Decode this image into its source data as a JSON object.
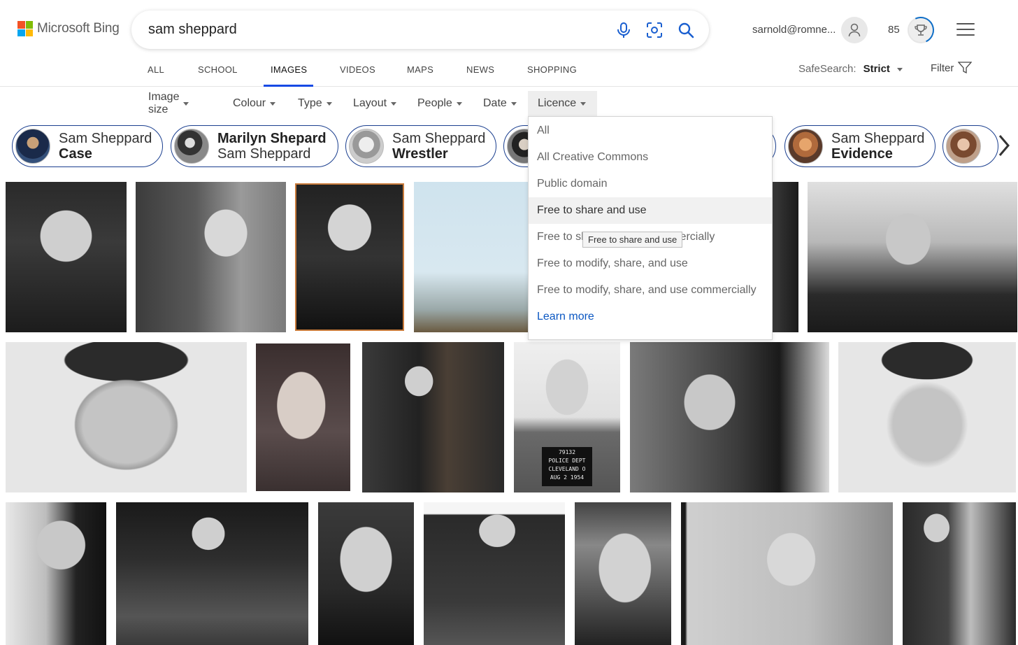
{
  "logo": {
    "text": "Microsoft Bing",
    "colors": [
      "#f35325",
      "#81bc06",
      "#05a6f0",
      "#ffba08"
    ]
  },
  "search": {
    "query": "sam sheppard",
    "mic_icon": "microphone-icon",
    "visual_search_icon": "visual-search-icon",
    "search_icon": "search-icon"
  },
  "header": {
    "account": "sarnold@romne...",
    "points": "85"
  },
  "nav": {
    "tabs": [
      {
        "label": "ALL"
      },
      {
        "label": "SCHOOL"
      },
      {
        "label": "IMAGES",
        "active": true
      },
      {
        "label": "VIDEOS"
      },
      {
        "label": "MAPS"
      },
      {
        "label": "NEWS"
      },
      {
        "label": "SHOPPING"
      }
    ],
    "safesearch_label": "SafeSearch:",
    "safesearch_value": "Strict",
    "filter_label": "Filter"
  },
  "filters": [
    {
      "label": "Image size"
    },
    {
      "label": "Colour"
    },
    {
      "label": "Type"
    },
    {
      "label": "Layout"
    },
    {
      "label": "People"
    },
    {
      "label": "Date"
    },
    {
      "label": "Licence",
      "open": true
    }
  ],
  "chips": [
    {
      "line1": "Sam Sheppard",
      "line2": "Case",
      "bold_line": 2
    },
    {
      "line1": "Marilyn Shepard",
      "line2": "Sam Sheppard",
      "bold_line": 1
    },
    {
      "line1": "Sam Sheppard",
      "line2": "Wrestler",
      "bold_line": 2
    },
    {
      "line1": "",
      "line2": "",
      "bold_line": 0
    },
    {
      "line1": "",
      "line2": "",
      "bold_line": 0
    },
    {
      "line1": "Sam Sheppard",
      "line2": "Evidence",
      "bold_line": 2
    },
    {
      "line1": "",
      "line2": "",
      "bold_line": 0
    }
  ],
  "licence_dropdown": {
    "items": [
      {
        "label": "All"
      },
      {
        "label": "All Creative Commons"
      },
      {
        "label": "Public domain"
      },
      {
        "label": "Free to share and use",
        "hovered": true
      },
      {
        "label": "Free to share and use commercially"
      },
      {
        "label": "Free to modify, share, and use"
      },
      {
        "label": "Free to modify, share, and use commercially"
      },
      {
        "label": "Learn more",
        "link": true
      }
    ],
    "tooltip": "Free to share and use"
  },
  "image_results": {
    "mugshot_caption": "79132\nPOLICE DEPT\nCLEVELAND O\nAUG 2 1954"
  }
}
